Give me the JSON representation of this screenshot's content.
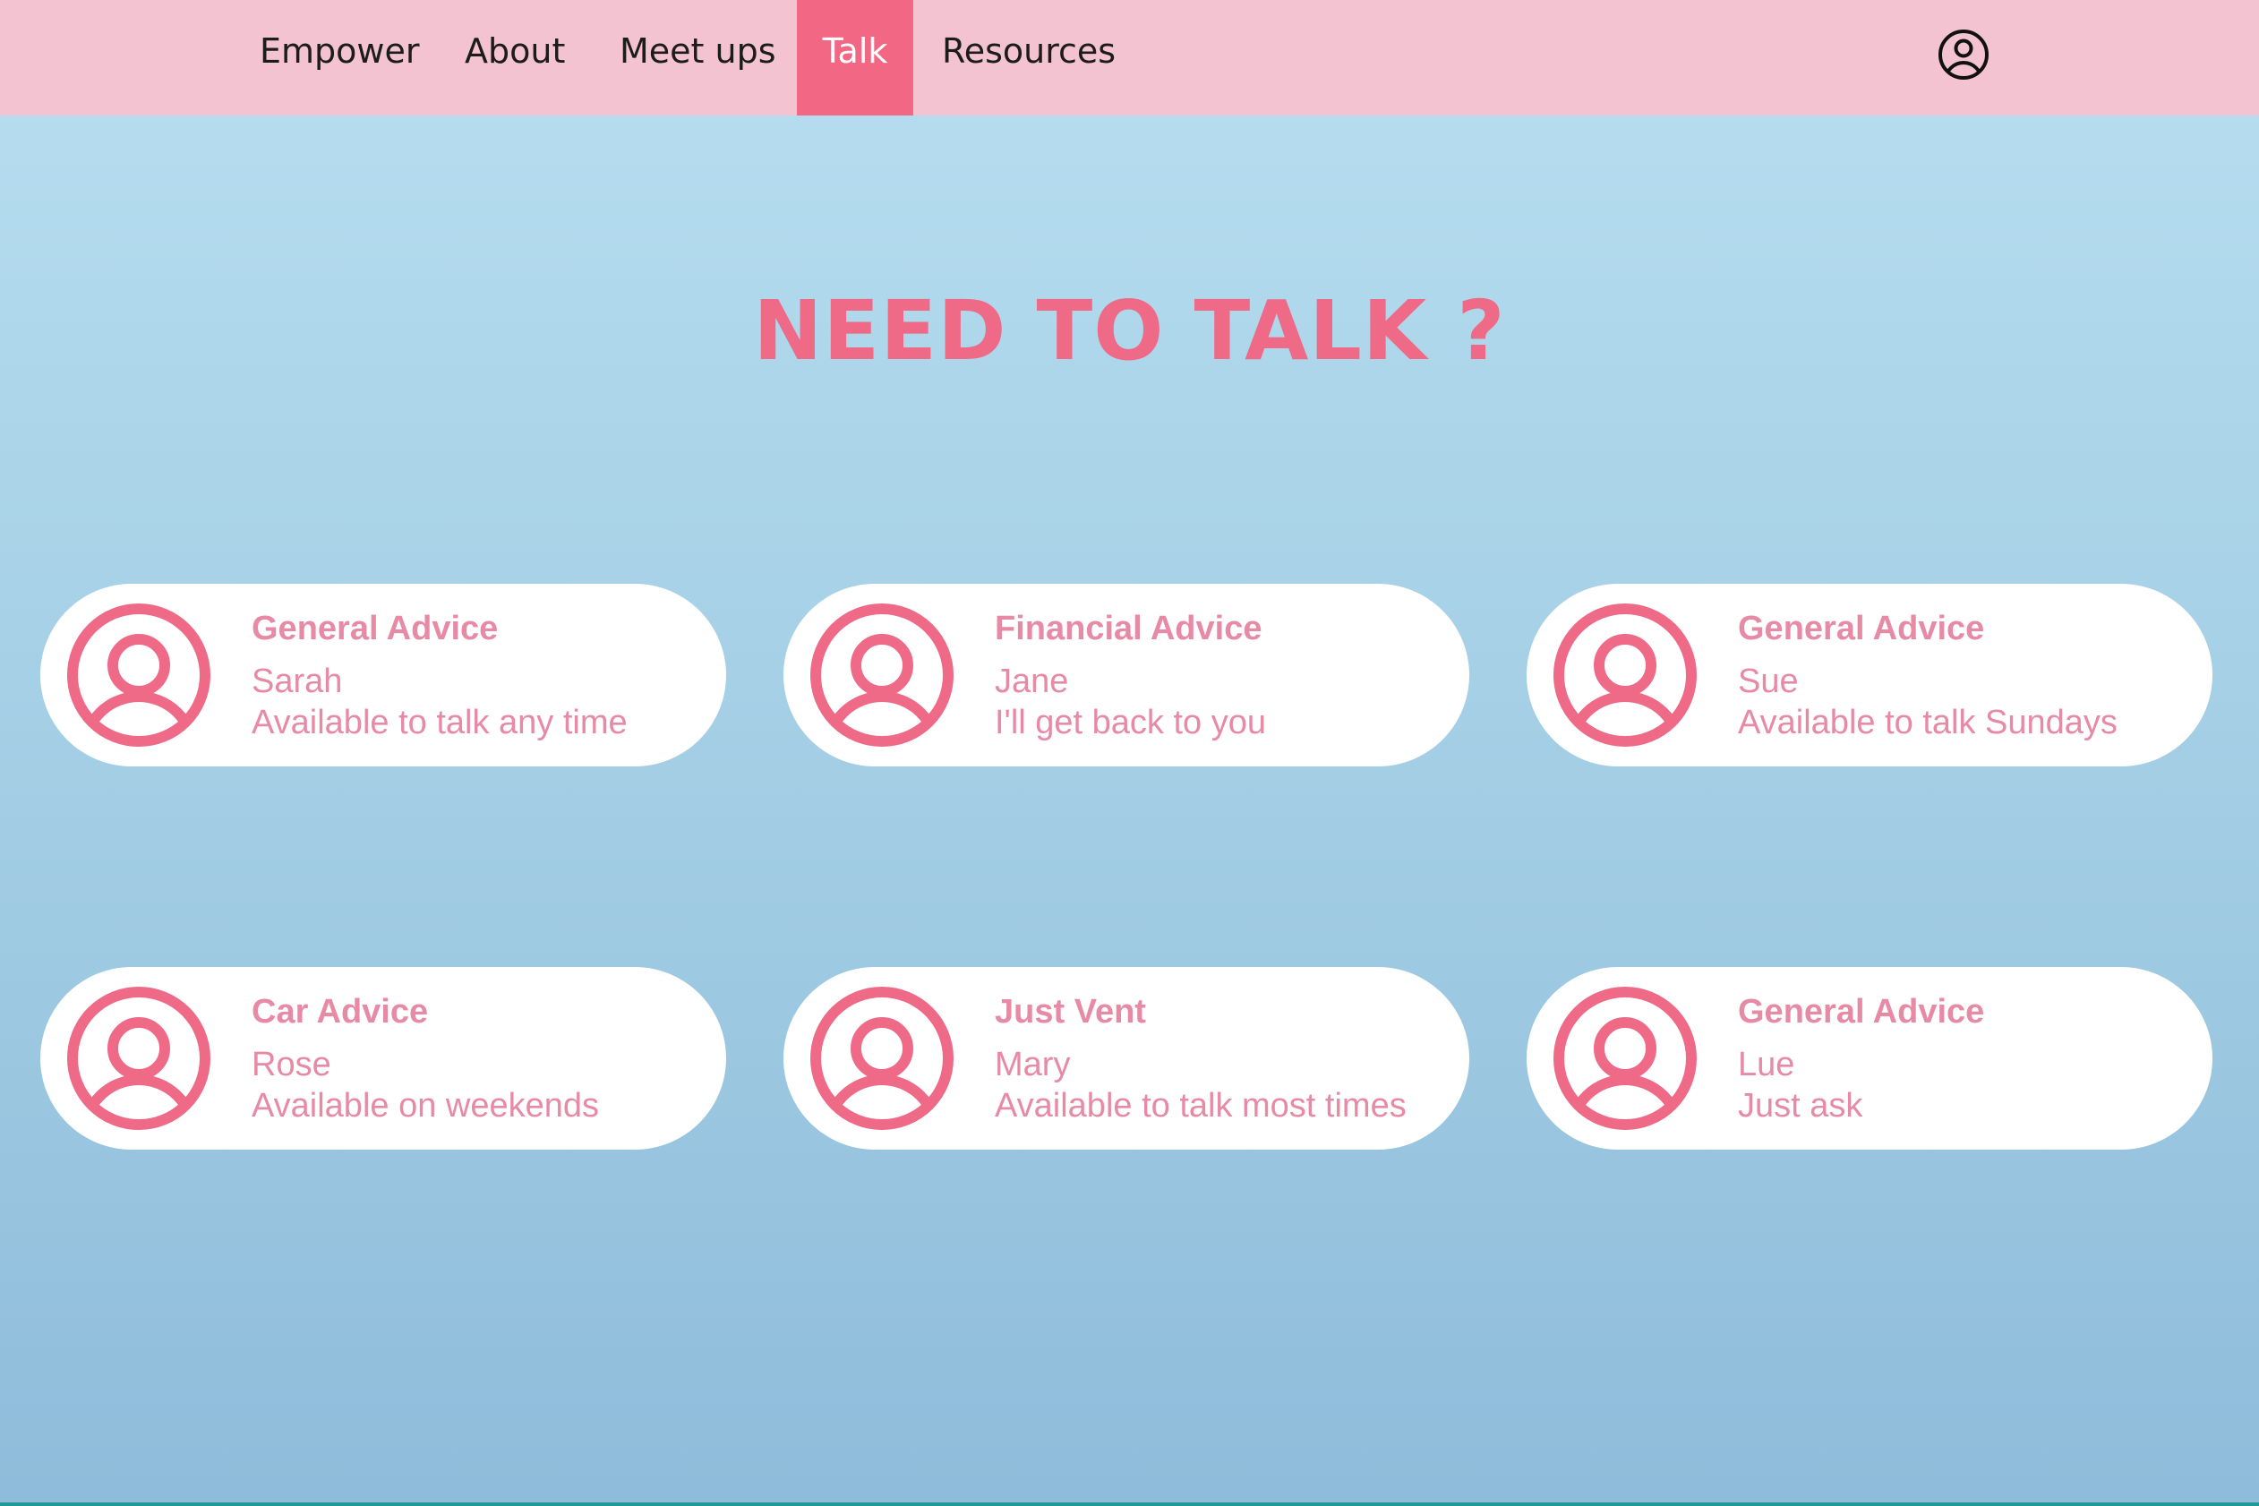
{
  "nav": {
    "items": [
      {
        "label": "Empower",
        "active": false
      },
      {
        "label": "About",
        "active": false
      },
      {
        "label": "Meet ups",
        "active": false
      },
      {
        "label": "Talk",
        "active": true
      },
      {
        "label": "Resources",
        "active": false
      }
    ],
    "user_icon": "user-circle-icon",
    "background_color": "#f3c3d1",
    "active_color": "#f26884"
  },
  "page": {
    "title": "NEED TO TALK ?",
    "title_color": "#ee6a87"
  },
  "cards": [
    {
      "category": "General Advice",
      "name": "Sarah",
      "availability": "Available to talk any time",
      "icon": "user-avatar-icon"
    },
    {
      "category": "Financial Advice",
      "name": "Jane",
      "availability": "I'll get back to you",
      "icon": "user-avatar-icon"
    },
    {
      "category": "General Advice",
      "name": "Sue",
      "availability": "Available to talk Sundays",
      "icon": "user-avatar-icon"
    },
    {
      "category": "Car Advice",
      "name": "Rose",
      "availability": "Available on weekends",
      "icon": "user-avatar-icon"
    },
    {
      "category": "Just Vent",
      "name": "Mary",
      "availability": "Available to talk most times",
      "icon": "user-avatar-icon"
    },
    {
      "category": "General Advice",
      "name": "Lue",
      "availability": "Just ask",
      "icon": "user-avatar-icon"
    }
  ],
  "colors": {
    "card_text": "#e78aa6",
    "avatar": "#ee6a87",
    "background_top": "#b8def0",
    "background_bottom": "#8ebcda"
  }
}
